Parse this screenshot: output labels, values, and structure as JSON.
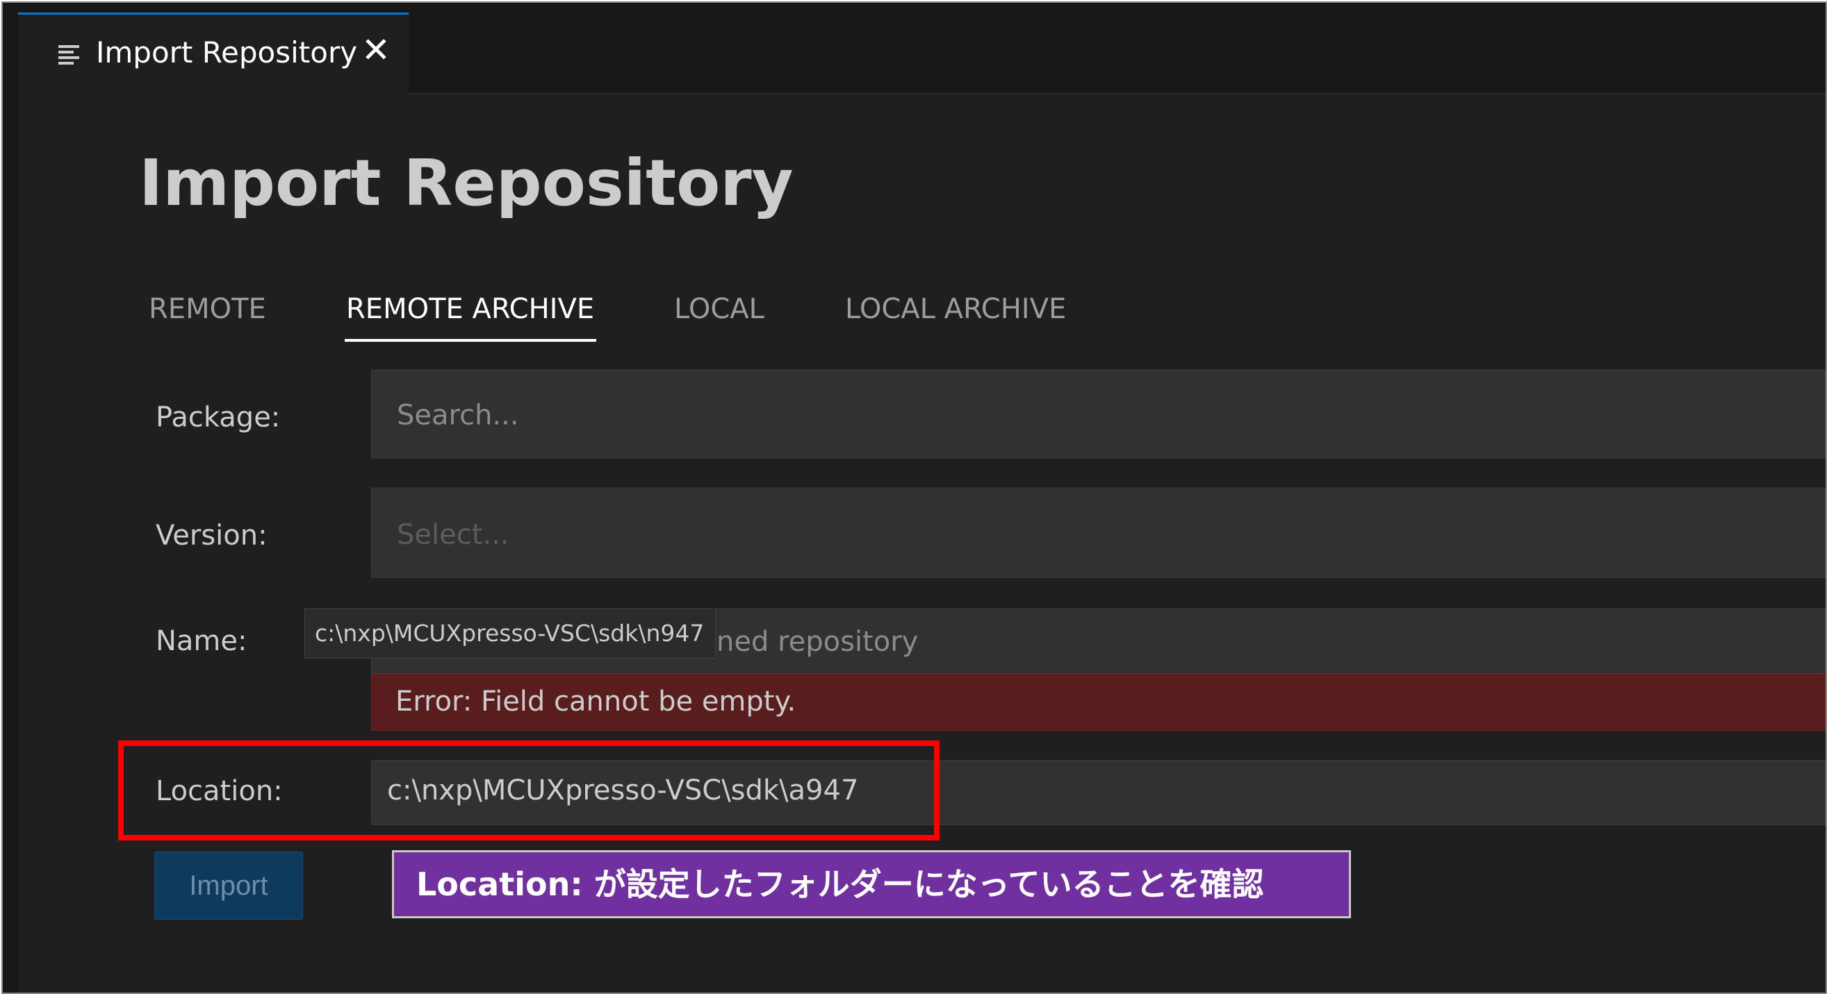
{
  "tab": {
    "icon": "list-icon",
    "label": "Import Repository",
    "close_glyph": "✕"
  },
  "page": {
    "title": "Import Repository"
  },
  "subtabs": [
    {
      "label": "REMOTE"
    },
    {
      "label": "REMOTE ARCHIVE"
    },
    {
      "label": "LOCAL"
    },
    {
      "label": "LOCAL ARCHIVE"
    }
  ],
  "active_subtab": "REMOTE ARCHIVE",
  "form": {
    "package": {
      "label": "Package:",
      "placeholder": "Search..."
    },
    "version": {
      "label": "Version:",
      "placeholder": "Select..."
    },
    "name": {
      "label": "Name:",
      "placeholder_visible": "ned repository",
      "tooltip": "c:\\nxp\\MCUXpresso-VSC\\sdk\\n947"
    },
    "error": "Error: Field cannot be empty.",
    "location": {
      "label": "Location:",
      "value": "c:\\nxp\\MCUXpresso-VSC\\sdk\\a947"
    },
    "import_button": "Import"
  },
  "annotation": {
    "callout": "Location: が設定したフォルダーになっていることを確認",
    "highlight_color": "#ff0000",
    "callout_color": "#7030a0"
  },
  "colors": {
    "background": "#1f1f1f",
    "accent": "#0078d4",
    "error_background": "#5a1d1d"
  }
}
